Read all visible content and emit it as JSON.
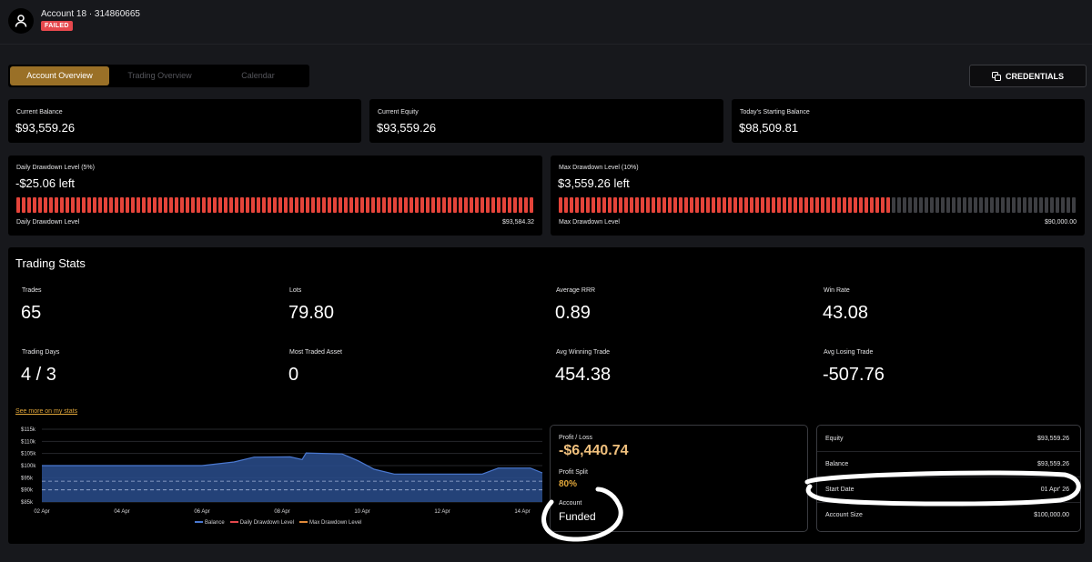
{
  "header": {
    "account_title": "Account 18 · 314860665",
    "status_badge": "FAILED"
  },
  "tabs": [
    {
      "label": "Account Overview",
      "active": true
    },
    {
      "label": "Trading Overview",
      "active": false
    },
    {
      "label": "Calendar",
      "active": false
    }
  ],
  "credentials_button": {
    "label": "CREDENTIALS",
    "icon": "copy-icon"
  },
  "balances": {
    "current_balance": {
      "label": "Current Balance",
      "value": "$93,559.26"
    },
    "current_equity": {
      "label": "Current Equity",
      "value": "$93,559.26"
    },
    "starting_balance": {
      "label": "Today's Starting Balance",
      "value": "$98,509.81"
    }
  },
  "drawdowns": {
    "daily": {
      "title": "Daily Drawdown Level (5%)",
      "remaining": "-$25.06 left",
      "footer_label": "Daily Drawdown Level",
      "footer_value": "$93,584.32",
      "fill_fraction": 1.0
    },
    "max": {
      "title": "Max Drawdown Level (10%)",
      "remaining": "$3,559.26 left",
      "footer_label": "Max Drawdown Level",
      "footer_value": "$90,000.00",
      "fill_fraction": 0.64
    }
  },
  "stats": {
    "title": "Trading Stats",
    "items": [
      {
        "label": "Trades",
        "value": "65"
      },
      {
        "label": "Lots",
        "value": "79.80"
      },
      {
        "label": "Average RRR",
        "value": "0.89"
      },
      {
        "label": "Win Rate",
        "value": "43.08"
      },
      {
        "label": "Trading Days",
        "value": "4 / 3"
      },
      {
        "label": "Most Traded Asset",
        "value": "0"
      },
      {
        "label": "Avg Winning Trade",
        "value": "454.38"
      },
      {
        "label": "Avg Losing Trade",
        "value": "-507.76"
      }
    ],
    "see_more_link": "See more on my stats"
  },
  "chart_data": {
    "type": "area",
    "y_tick_labels": [
      "$115k",
      "$110k",
      "$105k",
      "$100k",
      "$95k",
      "$90k",
      "$85k"
    ],
    "ylim": [
      85000,
      115000
    ],
    "x_tick_labels": [
      "02 Apr",
      "04 Apr",
      "06 Apr",
      "08 Apr",
      "10 Apr",
      "12 Apr",
      "14 Apr"
    ],
    "xlim": [
      2,
      14.5
    ],
    "series": [
      {
        "name": "Balance",
        "color": "#4a78d0",
        "x": [
          2,
          6.0,
          6.8,
          7.3,
          8.2,
          8.5,
          8.6,
          9.5,
          9.9,
          10.3,
          10.8,
          13.0,
          13.4,
          14.2,
          14.5
        ],
        "values": [
          100000,
          100000,
          101500,
          103500,
          103600,
          102500,
          105200,
          104800,
          102000,
          98500,
          96500,
          96500,
          99000,
          99000,
          97000
        ]
      },
      {
        "name": "Daily Drawdown Level",
        "color": "#e5484d",
        "constant": 93584.32
      },
      {
        "name": "Max Drawdown Level",
        "color": "#e08a3a",
        "constant": 90000
      }
    ],
    "grid": true,
    "legend_position": "bottom"
  },
  "pnl": {
    "pnl_label": "Profit / Loss",
    "pnl_value": "-$6,440.74",
    "split_label": "Profit Split",
    "split_value": "80%",
    "account_label": "Account",
    "account_value": "Funded"
  },
  "account_info": [
    {
      "label": "Equity",
      "value": "$93,559.26"
    },
    {
      "label": "Balance",
      "value": "$93,559.26"
    },
    {
      "label": "Start Date",
      "value": "01 Apr' 26"
    },
    {
      "label": "Account Size",
      "value": "$100,000.00"
    }
  ]
}
